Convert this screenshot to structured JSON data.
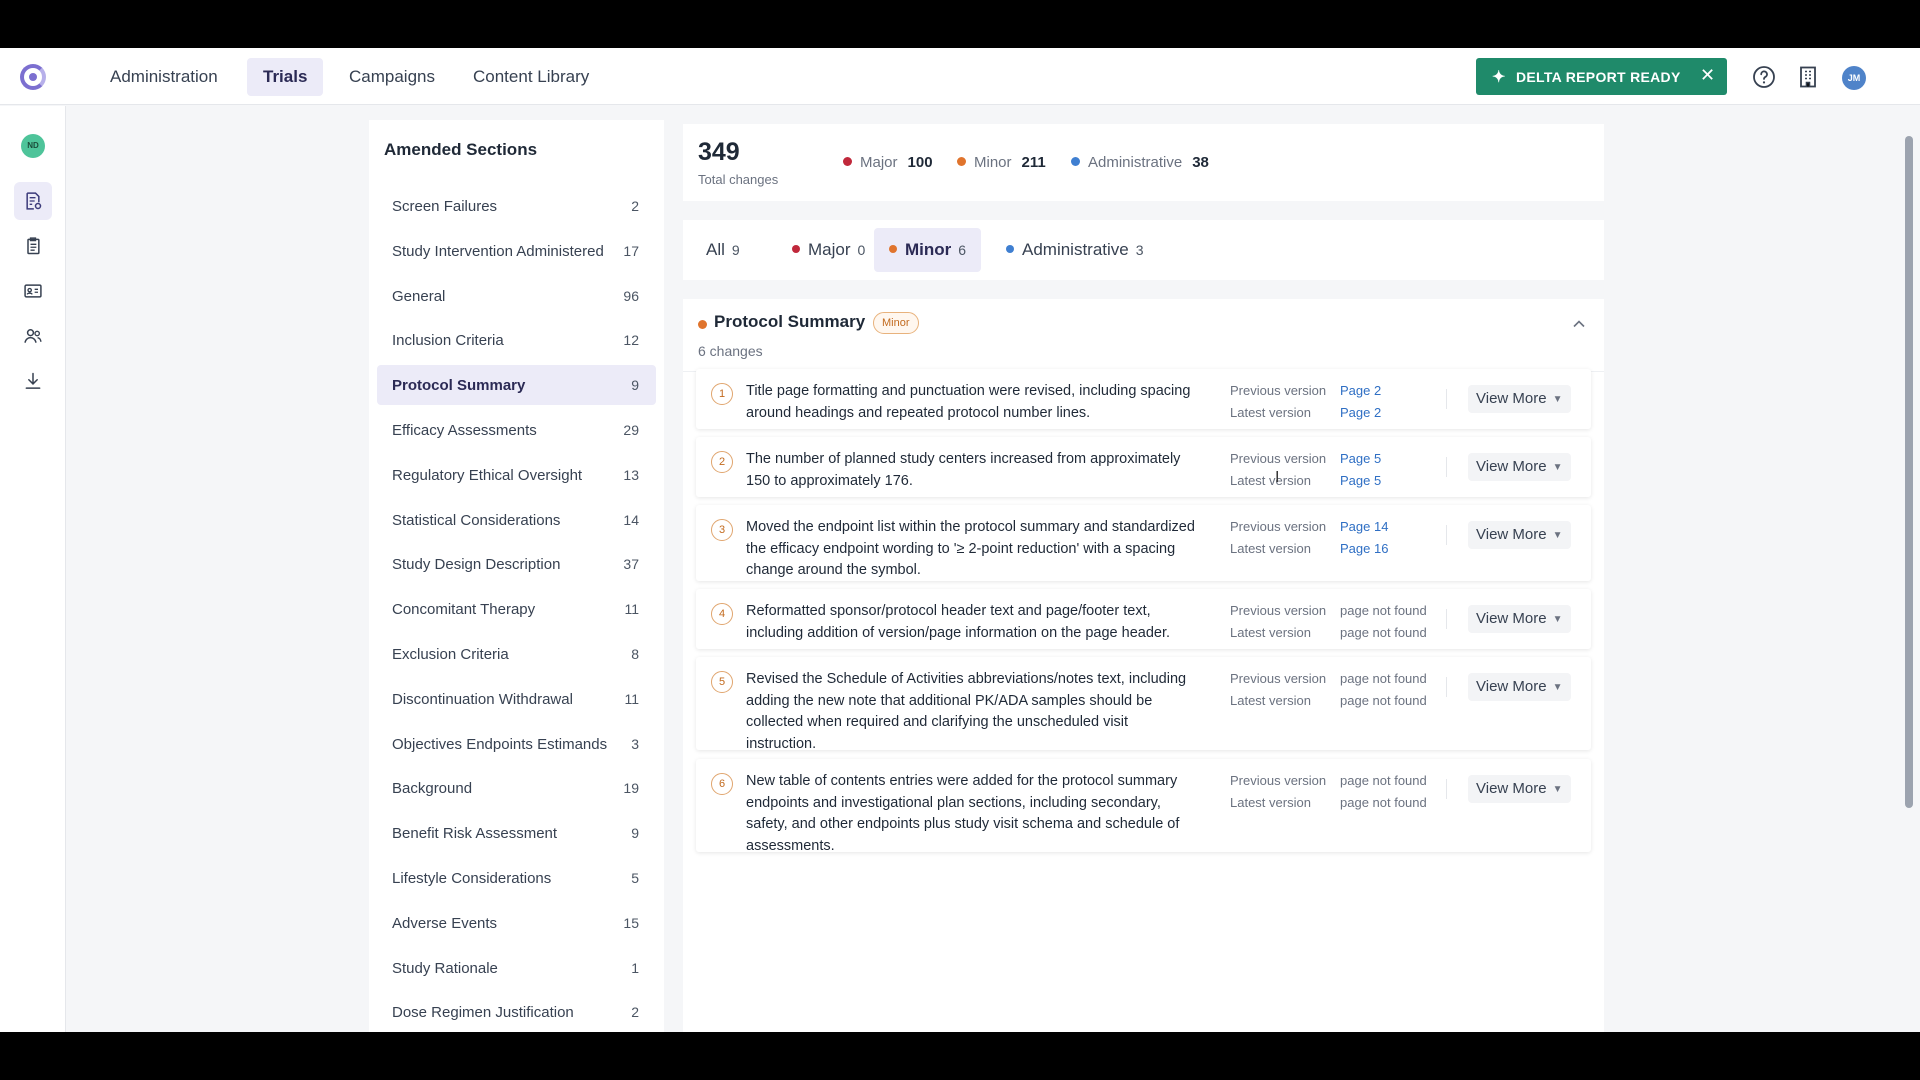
{
  "nav": {
    "tabs": [
      {
        "label": "Administration"
      },
      {
        "label": "Trials"
      },
      {
        "label": "Campaigns"
      },
      {
        "label": "Content Library"
      }
    ],
    "active_tab": "Trials",
    "delta_report_label": "DELTA REPORT READY",
    "user_initials": "JM",
    "colors": {
      "delta_bg": "#1f8a6a",
      "accent": "#7c6fd0"
    }
  },
  "rail": {
    "user_initials": "ND",
    "icons": [
      "protocol-settings-icon",
      "documents-icon",
      "id-card-icon",
      "users-icon",
      "download-icon"
    ]
  },
  "sidebar": {
    "title": "Amended Sections",
    "items": [
      {
        "name": "Screen Failures",
        "count": "2"
      },
      {
        "name": "Study Intervention Administered",
        "count": "17"
      },
      {
        "name": "General",
        "count": "96"
      },
      {
        "name": "Inclusion Criteria",
        "count": "12"
      },
      {
        "name": "Protocol Summary",
        "count": "9"
      },
      {
        "name": "Efficacy Assessments",
        "count": "29"
      },
      {
        "name": "Regulatory Ethical Oversight",
        "count": "13"
      },
      {
        "name": "Statistical Considerations",
        "count": "14"
      },
      {
        "name": "Study Design Description",
        "count": "37"
      },
      {
        "name": "Concomitant Therapy",
        "count": "11"
      },
      {
        "name": "Exclusion Criteria",
        "count": "8"
      },
      {
        "name": "Discontinuation Withdrawal",
        "count": "11"
      },
      {
        "name": "Objectives Endpoints Estimands",
        "count": "3"
      },
      {
        "name": "Background",
        "count": "19"
      },
      {
        "name": "Benefit Risk Assessment",
        "count": "9"
      },
      {
        "name": "Lifestyle Considerations",
        "count": "5"
      },
      {
        "name": "Adverse Events",
        "count": "15"
      },
      {
        "name": "Study Rationale",
        "count": "1"
      },
      {
        "name": "Dose Regimen Justification",
        "count": "2"
      }
    ],
    "active_item": "Protocol Summary"
  },
  "summary": {
    "total": "349",
    "total_label": "Total changes",
    "legend": [
      {
        "label": "Major",
        "value": "100",
        "color": "#c0283b"
      },
      {
        "label": "Minor",
        "value": "211",
        "color": "#e0742d"
      },
      {
        "label": "Administrative",
        "value": "38",
        "color": "#3f7fd1"
      }
    ]
  },
  "filters": [
    {
      "label": "All",
      "count": "9"
    },
    {
      "label": "Major",
      "count": "0",
      "color": "#c0283b"
    },
    {
      "label": "Minor",
      "count": "6",
      "color": "#e0742d"
    },
    {
      "label": "Administrative",
      "count": "3",
      "color": "#3f7fd1"
    }
  ],
  "active_filter": "Minor",
  "section": {
    "title": "Protocol Summary",
    "badge": "Minor",
    "subtitle": "6 changes",
    "previous_label": "Previous version",
    "latest_label": "Latest version",
    "view_more_label": "View More",
    "changes": [
      {
        "num": "1",
        "text": "Title page formatting and punctuation were revised, including spacing around headings and repeated protocol number lines.",
        "prev": "Page 2",
        "latest": "Page 2"
      },
      {
        "num": "2",
        "text": "The number of planned study centers increased from approximately 150 to approximately 176.",
        "prev": "Page 5",
        "latest": "Page 5"
      },
      {
        "num": "3",
        "text": "Moved the endpoint list within the protocol summary and standardized the efficacy endpoint wording to '≥ 2-point reduction' with a spacing change around the symbol.",
        "prev": "Page 14",
        "latest": "Page 16"
      },
      {
        "num": "4",
        "text": "Reformatted sponsor/protocol header text and page/footer text, including addition of version/page information on the page header.",
        "prev": "page not found",
        "latest": "page not found"
      },
      {
        "num": "5",
        "text": "Revised the Schedule of Activities abbreviations/notes text, including adding the new note that additional PK/ADA samples should be collected when required and clarifying the unscheduled visit instruction.",
        "prev": "page not found",
        "latest": "page not found"
      },
      {
        "num": "6",
        "text": "New table of contents entries were added for the protocol summary endpoints and investigational plan sections, including secondary, safety, and other endpoints plus study visit schema and schedule of assessments.",
        "prev": "page not found",
        "latest": "page not found"
      }
    ]
  }
}
